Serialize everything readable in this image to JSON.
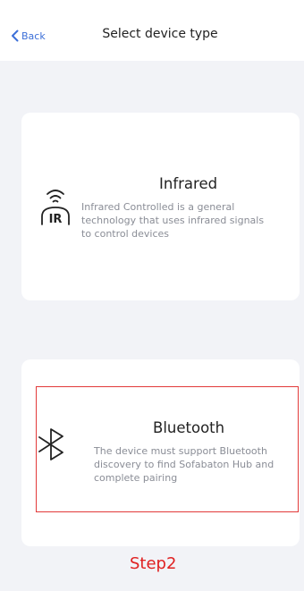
{
  "header": {
    "back_label": "Back",
    "title": "Select device type"
  },
  "options": [
    {
      "icon": "infrared-icon",
      "icon_text": "IR",
      "title": "Infrared",
      "description": "Infrared Controlled is a  general technology that uses infrared signals to control devices"
    },
    {
      "icon": "bluetooth-icon",
      "title": "Bluetooth",
      "description": "The device must support Bluetooth discovery to find Sofabaton Hub and complete pairing"
    }
  ],
  "annotation": {
    "label": "Step2",
    "color": "#e02020"
  },
  "colors": {
    "accent": "#3c6fd8",
    "background": "#f2f3f7",
    "card": "#ffffff"
  }
}
